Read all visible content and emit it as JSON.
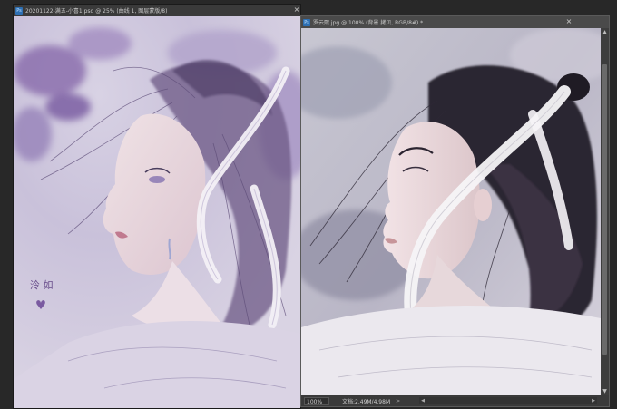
{
  "left_document": {
    "tab_title": "20201122-满五-小喜1.psd @ 25% (曲线 1, 图层蒙版/8)",
    "icon_label": "Ps",
    "close_glyph": "×",
    "signature_text": "泠 如"
  },
  "right_document": {
    "tab_title": "罗云熙.jpg @ 100% (背景 拷贝, RGB/8#) *",
    "icon_label": "Ps",
    "close_glyph": "×",
    "zoom": "100%",
    "doc_info": "文档:2.49M/4.98M",
    "status_arrow": ">",
    "scroll_up": "▲",
    "scroll_down": "▼",
    "scroll_left": "◀",
    "scroll_right": "▶",
    "scroll_position": 0.0
  },
  "colors": {
    "workspace": "#282828",
    "panel": "#3a3a3a",
    "accent_icon": "#2d6fb3"
  }
}
